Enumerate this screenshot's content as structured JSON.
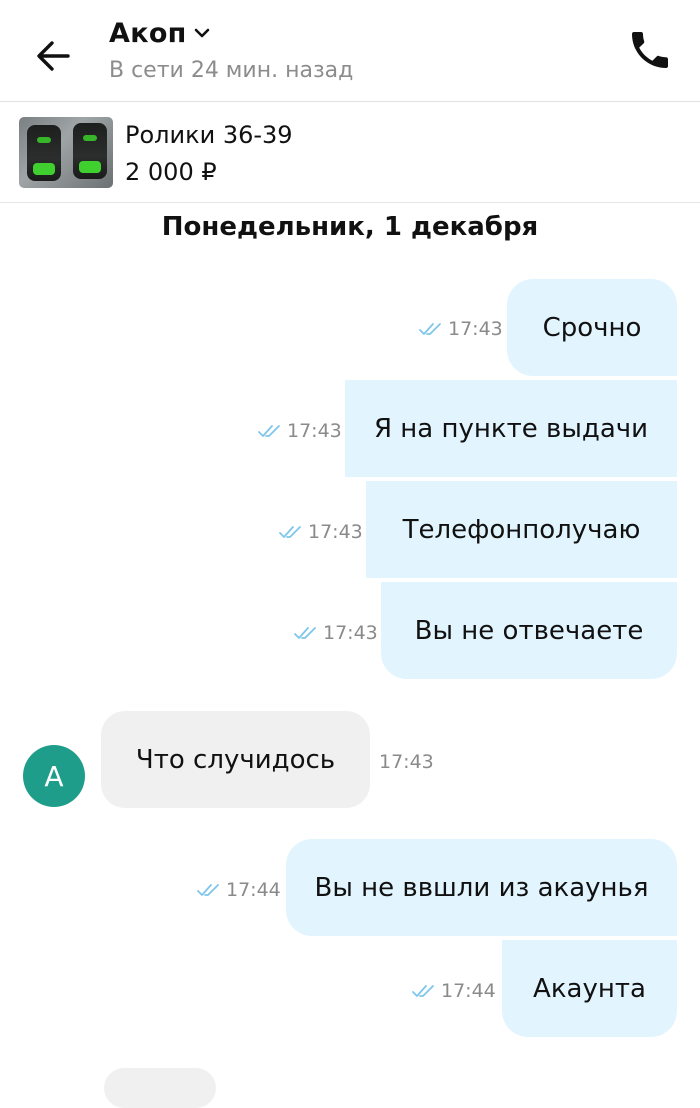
{
  "header": {
    "contact_name": "Акоп",
    "status": "В сети 24 мин. назад",
    "back_icon": "arrow-left-icon",
    "call_icon": "phone-icon"
  },
  "product": {
    "title": "Ролики 36-39",
    "price": "2 000 ₽"
  },
  "date_separator": "Понедельник, 1 декабря",
  "avatar_letter": "А",
  "colors": {
    "outgoing_bubble": "#e2f4fd",
    "incoming_bubble": "#f0f0f0",
    "avatar": "#1e9e8a",
    "read_ticks": "#7fc6ea"
  },
  "messages": [
    {
      "direction": "out",
      "text": "Срочно",
      "time": "17:43",
      "read": true
    },
    {
      "direction": "out",
      "text": "Я на пункте выдачи",
      "time": "17:43",
      "read": true
    },
    {
      "direction": "out",
      "text": "Телефонполучаю",
      "time": "17:43",
      "read": true
    },
    {
      "direction": "out",
      "text": "Вы не отвечаете",
      "time": "17:43",
      "read": true
    },
    {
      "direction": "in",
      "text": "Что случидось",
      "time": "17:43"
    },
    {
      "direction": "out",
      "text": "Вы не ввшли из акаунья",
      "time": "17:44",
      "read": true
    },
    {
      "direction": "out",
      "text": "Акаунта",
      "time": "17:44",
      "read": true
    }
  ]
}
